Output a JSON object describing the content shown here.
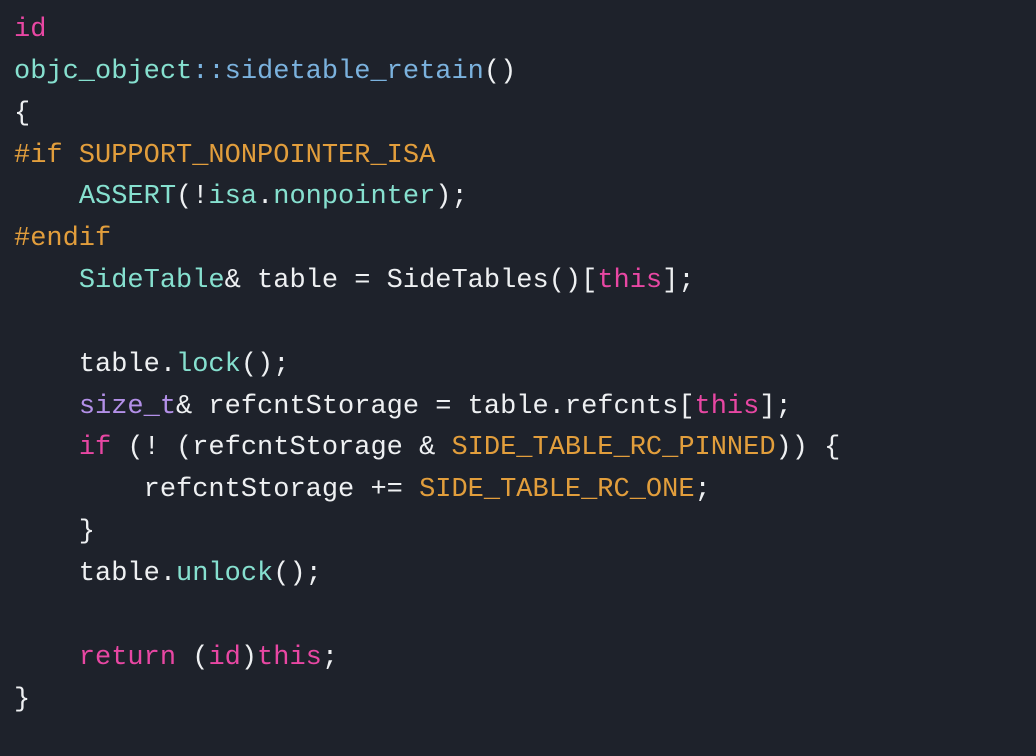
{
  "code": {
    "lines": [
      [
        {
          "cls": "c-keyword",
          "text": "id"
        }
      ],
      [
        {
          "cls": "c-type",
          "text": "objc_object"
        },
        {
          "cls": "c-func",
          "text": "::"
        },
        {
          "cls": "c-func",
          "text": "sidetable_retain"
        },
        {
          "cls": "c-default",
          "text": "()"
        }
      ],
      [
        {
          "cls": "c-default",
          "text": "{"
        }
      ],
      [
        {
          "cls": "c-macro",
          "text": "#if SUPPORT_NONPOINTER_ISA"
        }
      ],
      [
        {
          "cls": "c-default",
          "text": "    "
        },
        {
          "cls": "c-type",
          "text": "ASSERT"
        },
        {
          "cls": "c-default",
          "text": "(!"
        },
        {
          "cls": "c-type",
          "text": "isa"
        },
        {
          "cls": "c-default",
          "text": "."
        },
        {
          "cls": "c-type",
          "text": "nonpointer"
        },
        {
          "cls": "c-default",
          "text": ");"
        }
      ],
      [
        {
          "cls": "c-macro",
          "text": "#endif"
        }
      ],
      [
        {
          "cls": "c-default",
          "text": "    "
        },
        {
          "cls": "c-type",
          "text": "SideTable"
        },
        {
          "cls": "c-default",
          "text": "& table = SideTables()["
        },
        {
          "cls": "c-keyword",
          "text": "this"
        },
        {
          "cls": "c-default",
          "text": "];"
        }
      ],
      [
        {
          "cls": "c-default",
          "text": "    "
        }
      ],
      [
        {
          "cls": "c-default",
          "text": "    table."
        },
        {
          "cls": "c-type",
          "text": "lock"
        },
        {
          "cls": "c-default",
          "text": "();"
        }
      ],
      [
        {
          "cls": "c-default",
          "text": "    "
        },
        {
          "cls": "c-type2",
          "text": "size_t"
        },
        {
          "cls": "c-default",
          "text": "& refcntStorage = table.refcnts["
        },
        {
          "cls": "c-keyword",
          "text": "this"
        },
        {
          "cls": "c-default",
          "text": "];"
        }
      ],
      [
        {
          "cls": "c-default",
          "text": "    "
        },
        {
          "cls": "c-keyword",
          "text": "if"
        },
        {
          "cls": "c-default",
          "text": " (! (refcntStorage & "
        },
        {
          "cls": "c-macro",
          "text": "SIDE_TABLE_RC_PINNED"
        },
        {
          "cls": "c-default",
          "text": ")) {"
        }
      ],
      [
        {
          "cls": "c-default",
          "text": "        refcntStorage += "
        },
        {
          "cls": "c-macro",
          "text": "SIDE_TABLE_RC_ONE"
        },
        {
          "cls": "c-default",
          "text": ";"
        }
      ],
      [
        {
          "cls": "c-default",
          "text": "    }"
        }
      ],
      [
        {
          "cls": "c-default",
          "text": "    table."
        },
        {
          "cls": "c-type",
          "text": "unlock"
        },
        {
          "cls": "c-default",
          "text": "();"
        }
      ],
      [
        {
          "cls": "c-default",
          "text": ""
        }
      ],
      [
        {
          "cls": "c-default",
          "text": "    "
        },
        {
          "cls": "c-keyword",
          "text": "return"
        },
        {
          "cls": "c-default",
          "text": " ("
        },
        {
          "cls": "c-keyword",
          "text": "id"
        },
        {
          "cls": "c-default",
          "text": ")"
        },
        {
          "cls": "c-keyword",
          "text": "this"
        },
        {
          "cls": "c-default",
          "text": ";"
        }
      ],
      [
        {
          "cls": "c-default",
          "text": "}"
        }
      ]
    ]
  }
}
